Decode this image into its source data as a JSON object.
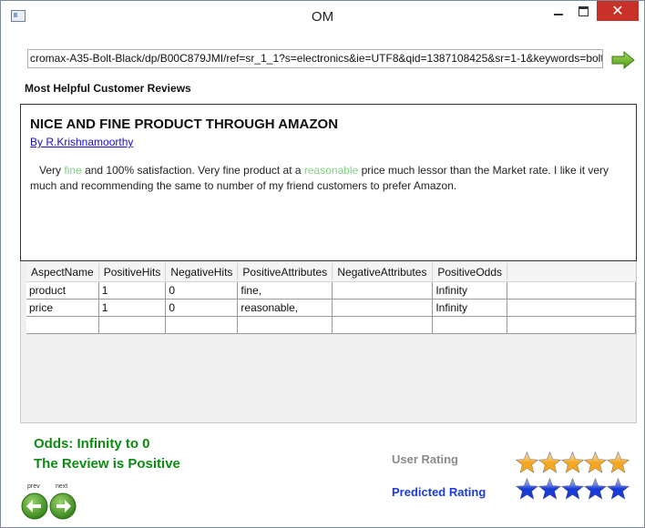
{
  "window": {
    "title": "OM"
  },
  "address": {
    "url": "cromax-A35-Bolt-Black/dp/B00C879JMI/ref=sr_1_1?s=electronics&ie=UTF8&qid=1387108425&sr=1-1&keywords=bolt"
  },
  "section_label": "Most Helpful Customer Reviews",
  "review": {
    "title": "NICE AND FINE PRODUCT THROUGH AMAZON",
    "author": "By R.Krishnamoorthy",
    "body_part1": "Very ",
    "highlight1": "fine",
    "body_part2": " and 100% satisfaction.  Very fine product at a ",
    "highlight2": "reasonable",
    "body_part3": " price much lessor than the Market rate.  I like it very much and recommending the same to number of my friend customers to prefer Amazon.",
    "highlight_color": "#7fd17f"
  },
  "grid": {
    "columns": [
      "AspectName",
      "PositiveHits",
      "NegativeHits",
      "PositiveAttributes",
      "NegativeAttributes",
      "PositiveOdds"
    ],
    "rows": [
      [
        "product",
        "1",
        "0",
        "fine,",
        "",
        "Infinity"
      ],
      [
        "price",
        "1",
        "0",
        "reasonable,",
        "",
        "Infinity"
      ]
    ]
  },
  "result": {
    "odds": "Odds: Infinity to 0",
    "verdict": "The Review is Positive",
    "color": "#0d8a12"
  },
  "ratings": {
    "user_label": "User Rating",
    "predicted_label": "Predicted Rating",
    "user_stars": 5,
    "predicted_stars": 5,
    "user_star_color": "#f5a623",
    "predicted_star_color": "#1a3cd6"
  },
  "nav": {
    "prev_label": "prev",
    "next_label": "next",
    "icons": [
      "left-arrow-icon",
      "right-arrow-icon"
    ]
  }
}
